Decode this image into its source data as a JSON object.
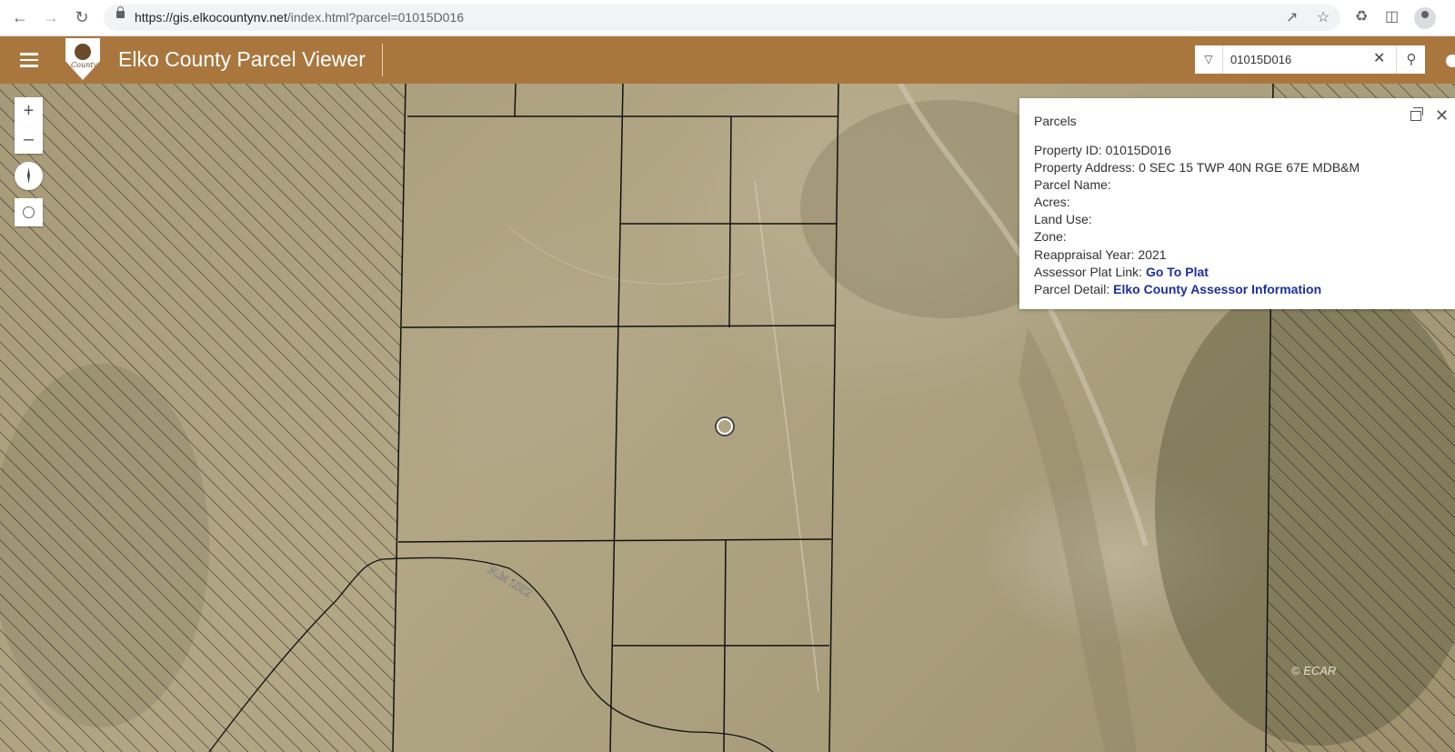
{
  "browser": {
    "url_host": "https://gis.elkocountynv.net",
    "url_path": "/index.html?parcel=01015D016",
    "icons": [
      "back-icon",
      "forward-icon",
      "reload-icon",
      "lock-icon",
      "share-icon",
      "bookmark-star-icon",
      "extensions-icon",
      "side-panel-icon",
      "profile-icon"
    ]
  },
  "header": {
    "title": "Elko County Parcel Viewer",
    "logo_text": "County",
    "search_value": "01015D016",
    "colors": {
      "header_bg": "#a9773e",
      "link": "#1d2ea3"
    }
  },
  "map": {
    "controls": [
      "zoom-in",
      "zoom-out",
      "compass",
      "locate"
    ],
    "road_label": "BLM 1552",
    "attribution": "© ECAR"
  },
  "popup": {
    "title": "Parcels",
    "fields": [
      {
        "label": "Property ID:",
        "value": "01015D016"
      },
      {
        "label": "Property Address:",
        "value": "0 SEC 15 TWP 40N RGE 67E MDB&M"
      },
      {
        "label": "Parcel Name:",
        "value": ""
      },
      {
        "label": "Acres:",
        "value": ""
      },
      {
        "label": "Land Use:",
        "value": ""
      },
      {
        "label": "Zone:",
        "value": ""
      },
      {
        "label": "Reappraisal Year:",
        "value": "2021"
      }
    ],
    "links": [
      {
        "label": "Assessor Plat Link:",
        "link_text": "Go To Plat"
      },
      {
        "label": "Parcel Detail:",
        "link_text": "Elko County Assessor Information"
      }
    ]
  }
}
